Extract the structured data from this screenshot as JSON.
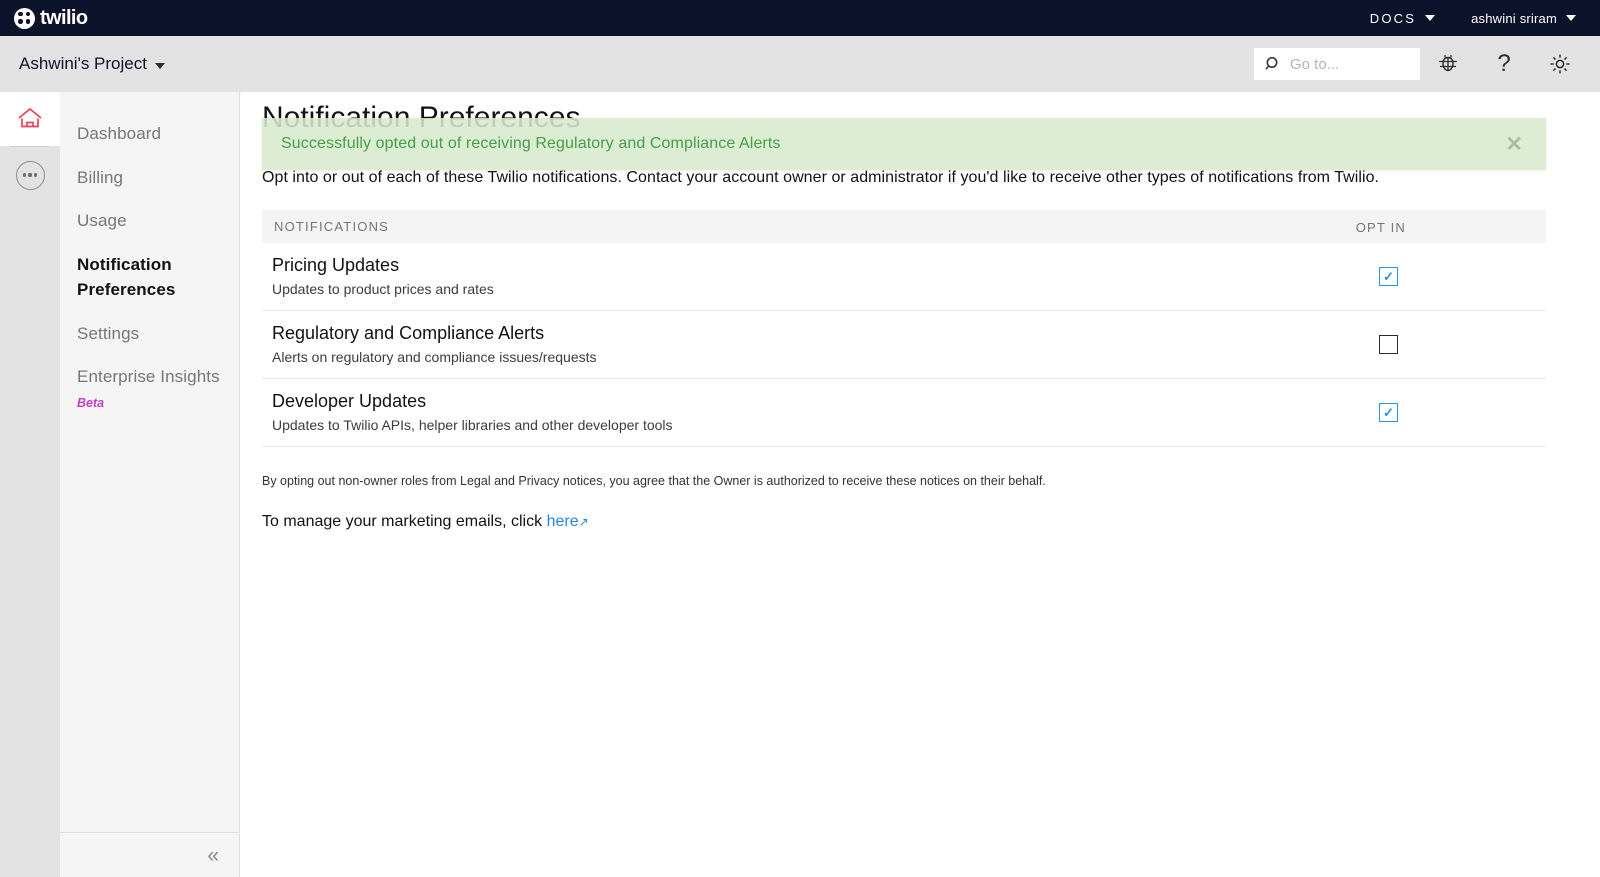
{
  "topbar": {
    "logo_text": "twilio",
    "docs_label": "DOCS",
    "user_label": "ashwini sriram"
  },
  "subbar": {
    "project_label": "Ashwini's Project",
    "search_placeholder": "Go to...",
    "icons": [
      "debugger-icon",
      "help-icon",
      "settings-icon"
    ]
  },
  "rail": {
    "home_icon": "home-icon",
    "more_icon": "ellipsis-icon"
  },
  "sidebar": {
    "items": [
      {
        "label": "Dashboard",
        "active": false
      },
      {
        "label": "Billing",
        "active": false
      },
      {
        "label": "Usage",
        "active": false
      },
      {
        "label": "Notification Preferences",
        "active": true
      },
      {
        "label": "Settings",
        "active": false
      },
      {
        "label": "Enterprise Insights",
        "active": false,
        "badge": "Beta"
      }
    ],
    "collapse_glyph": "«"
  },
  "main": {
    "page_title": "Notification Preferences",
    "banner": {
      "message": "Successfully opted out of receiving Regulatory and Compliance Alerts",
      "close_glyph": "✕",
      "color": "#45a049",
      "background": "#d7ebcd"
    },
    "intro": "Opt into or out of each of these Twilio notifications. Contact your account owner or administrator if you'd like to receive other types of notifications from Twilio.",
    "table": {
      "col_notifications": "NOTIFICATIONS",
      "col_opt_in": "OPT IN",
      "rows": [
        {
          "title": "Pricing Updates",
          "desc": "Updates to product prices and rates",
          "checked": true,
          "check_glyph": "✓"
        },
        {
          "title": "Regulatory and Compliance Alerts",
          "desc": "Alerts on regulatory and compliance issues/requests",
          "checked": false,
          "check_glyph": ""
        },
        {
          "title": "Developer Updates",
          "desc": "Updates to Twilio APIs, helper libraries and other developer tools",
          "checked": true,
          "check_glyph": "✓"
        }
      ]
    },
    "legal_note": "By opting out non-owner roles from Legal and Privacy notices, you agree that the Owner is authorized to receive these notices on their behalf.",
    "marketing_text": "To manage your marketing emails, click",
    "marketing_link": "here",
    "marketing_link_arrow": "↗"
  }
}
